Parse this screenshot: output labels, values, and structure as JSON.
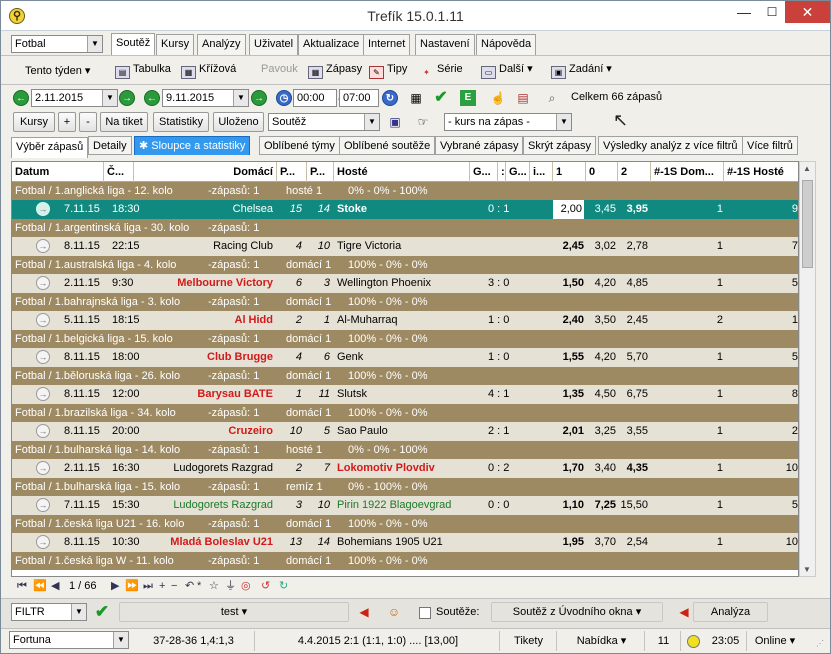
{
  "window": {
    "title": "Trefík 15.0.1.11",
    "min": "—",
    "max": "☐",
    "close": "✕"
  },
  "sport_select": "Fotbal",
  "tabs": [
    "Soutěž",
    "Kursy",
    "Analýzy",
    "Uživatel",
    "Aktualizace",
    "Internet",
    "Nastavení",
    "Nápověda"
  ],
  "toolbar1": {
    "week": "Tento týden ▾",
    "table": "Tabulka",
    "cross": "Křížová",
    "spider": "Pavouk",
    "matches": "Zápasy",
    "tips": "Tipy",
    "series": "Série",
    "more": "Další ▾",
    "assign": "Zadání ▾"
  },
  "toolbar2": {
    "date_from": "2.11.2015",
    "date_to": "9.11.2015",
    "time_from": "00:00",
    "time_to": "07:00",
    "total": "Celkem 66 zápasů"
  },
  "toolbar3": {
    "kursy": "Kursy",
    "plus": "+",
    "minus": "-",
    "na_tiket": "Na tiket",
    "statistiky": "Statistiky",
    "ulozeno": "Uloženo",
    "soutez": "Soutěž",
    "kurs": "- kurs na zápas -"
  },
  "subtabs": [
    "Výběr zápasů",
    "Detaily",
    "Sloupce a statistiky",
    "Oblíbené týmy",
    "Oblíbené soutěže",
    "Vybrané zápasy",
    "Skrýt zápasy",
    "Výsledky analýz z více filtrů",
    "Více filtrů"
  ],
  "columns": [
    "Datum",
    "Č...",
    "Domácí",
    "P...",
    "P...",
    "Hosté",
    "G...",
    ":",
    "G...",
    "i...",
    "1",
    "0",
    "2",
    "#-1S Dom...",
    "#-1S Hosté"
  ],
  "groups": [
    {
      "name": "Fotbal / 1.anglická liga - 12. kolo",
      "count": "-zápasů: 1",
      "winner": "hosté 1",
      "pct": "0% - 0% - 100%",
      "match": {
        "date": "7.11.15",
        "time": "18:30",
        "home": "Chelsea",
        "hp": "15",
        "ap": "14",
        "away": "Stoke",
        "score": "0 : 1",
        "o1": "2,00",
        "ox": "3,45",
        "o2": "3,95",
        "s1": "1",
        "s2": "9",
        "hl": true
      }
    },
    {
      "name": "Fotbal / 1.argentinská liga - 30. kolo",
      "count": "-zápasů: 1",
      "winner": "",
      "pct": "",
      "match": {
        "date": "8.11.15",
        "time": "22:15",
        "home": "Racing Club",
        "hp": "4",
        "ap": "10",
        "away": "Tigre Victoria",
        "score": "",
        "o1": "2,45",
        "ox": "3,02",
        "o2": "2,78",
        "s1": "1",
        "s2": "7"
      }
    },
    {
      "name": "Fotbal / 1.australská liga - 4. kolo",
      "count": "-zápasů: 1",
      "winner": "domácí 1",
      "pct": "100% - 0% - 0%",
      "match": {
        "date": "2.11.15",
        "time": "9:30",
        "home": "Melbourne Victory",
        "hp": "6",
        "ap": "3",
        "away": "Wellington Phoenix",
        "score": "3 : 0",
        "o1": "1,50",
        "ox": "4,20",
        "o2": "4,85",
        "s1": "1",
        "s2": "5",
        "hred": true
      }
    },
    {
      "name": "Fotbal / 1.bahrajnská liga - 3. kolo",
      "count": "-zápasů: 1",
      "winner": "domácí 1",
      "pct": "100% - 0% - 0%",
      "match": {
        "date": "5.11.15",
        "time": "18:15",
        "home": "Al Hidd",
        "hp": "2",
        "ap": "1",
        "away": "Al-Muharraq",
        "score": "1 : 0",
        "o1": "2,40",
        "ox": "3,50",
        "o2": "2,45",
        "s1": "2",
        "s2": "1",
        "hred": true
      }
    },
    {
      "name": "Fotbal / 1.belgická liga - 15. kolo",
      "count": "-zápasů: 1",
      "winner": "domácí 1",
      "pct": "100% - 0% - 0%",
      "match": {
        "date": "8.11.15",
        "time": "18:00",
        "home": "Club Brugge",
        "hp": "4",
        "ap": "6",
        "away": "Genk",
        "score": "1 : 0",
        "o1": "1,55",
        "ox": "4,20",
        "o2": "5,70",
        "s1": "1",
        "s2": "5",
        "hred": true
      }
    },
    {
      "name": "Fotbal / 1.běloruská liga - 26. kolo",
      "count": "-zápasů: 1",
      "winner": "domácí 1",
      "pct": "100% - 0% - 0%",
      "match": {
        "date": "8.11.15",
        "time": "12:00",
        "home": "Barysau BATE",
        "hp": "1",
        "ap": "11",
        "away": "Slutsk",
        "score": "4 : 1",
        "o1": "1,35",
        "ox": "4,50",
        "o2": "6,75",
        "s1": "1",
        "s2": "8",
        "hred": true
      }
    },
    {
      "name": "Fotbal / 1.brazilská liga - 34. kolo",
      "count": "-zápasů: 1",
      "winner": "domácí 1",
      "pct": "100% - 0% - 0%",
      "match": {
        "date": "8.11.15",
        "time": "20:00",
        "home": "Cruzeiro",
        "hp": "10",
        "ap": "5",
        "away": "Sao Paulo",
        "score": "2 : 1",
        "o1": "2,01",
        "ox": "3,25",
        "o2": "3,55",
        "s1": "1",
        "s2": "2",
        "hred": true
      }
    },
    {
      "name": "Fotbal / 1.bulharská liga - 14. kolo",
      "count": "-zápasů: 1",
      "winner": "hosté 1",
      "pct": "0% - 0% - 100%",
      "match": {
        "date": "2.11.15",
        "time": "16:30",
        "home": "Ludogorets Razgrad",
        "hp": "2",
        "ap": "7",
        "away": "Lokomotiv Plovdiv",
        "score": "0 : 2",
        "o1": "1,70",
        "ox": "3,40",
        "o2": "4,35",
        "s1": "1",
        "s2": "10",
        "ared": true
      }
    },
    {
      "name": "Fotbal / 1.bulharská liga - 15. kolo",
      "count": "-zápasů: 1",
      "winner": "remíz 1",
      "pct": "0% - 100% - 0%",
      "match": {
        "date": "7.11.15",
        "time": "15:30",
        "home": "Ludogorets Razgrad",
        "hp": "3",
        "ap": "10",
        "away": "Pirin 1922 Blagoevgrad",
        "score": "0 : 0",
        "o1": "1,10",
        "ox": "7,25",
        "o2": "15,50",
        "s1": "1",
        "s2": "5",
        "green": true
      }
    },
    {
      "name": "Fotbal / 1.česká liga U21 - 16. kolo",
      "count": "-zápasů: 1",
      "winner": "domácí 1",
      "pct": "100% - 0% - 0%",
      "match": {
        "date": "8.11.15",
        "time": "10:30",
        "home": "Mladá Boleslav U21",
        "hp": "13",
        "ap": "14",
        "away": "Bohemians 1905 U21",
        "score": "",
        "o1": "1,95",
        "ox": "3,70",
        "o2": "2,54",
        "s1": "1",
        "s2": "10",
        "hred": true
      }
    },
    {
      "name": "Fotbal / 1.česká liga W - 11. kolo",
      "count": "-zápasů: 1",
      "winner": "domácí 1",
      "pct": "100% - 0% - 0%"
    }
  ],
  "nav": {
    "page": "1 / 66"
  },
  "bottom": {
    "filter": "FILTR",
    "test": "test ▾",
    "soutezes": "Soutěže:",
    "z_okna": "Soutěž z Úvodního okna ▾",
    "analyza": "Analýza"
  },
  "status": {
    "bookie": "Fortuna",
    "record": "37-28-36  1,4:1,3",
    "last": "4.4.2015 2:1 (1:1, 1:0) .... [13,00]",
    "tikety": "Tikety",
    "nabidka": "Nabídka ▾",
    "count": "11",
    "time": "23:05",
    "online": "Online ▾"
  }
}
